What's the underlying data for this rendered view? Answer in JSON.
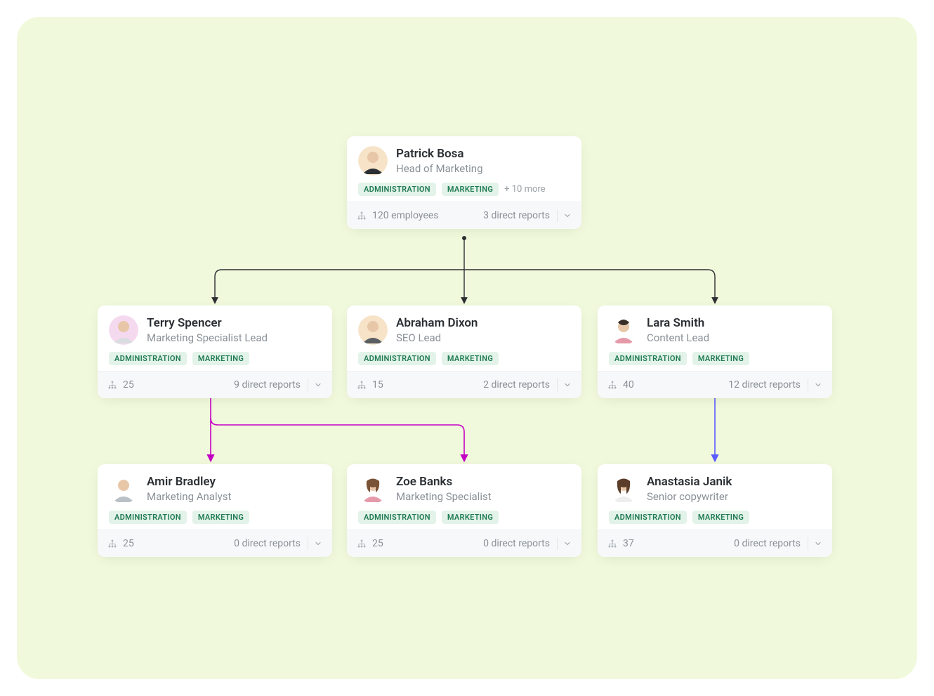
{
  "labels": {
    "employees_word": "employees",
    "direct_reports_word": "direct reports"
  },
  "tag_admin": "ADMINISTRATION",
  "tag_mkt": "MARKETING",
  "root": {
    "name": "Patrick Bosa",
    "title": "Head of Marketing",
    "more": "+ 10 more",
    "employees": "120 employees",
    "reports": "3 direct reports",
    "avatar_bg": "#f6e3c8",
    "avatar_shirt": "#2b2f33"
  },
  "row2": [
    {
      "name": "Terry Spencer",
      "title": "Marketing Specialist Lead",
      "employees": "25",
      "reports": "9 direct reports",
      "avatar_bg": "#f5d9ef",
      "avatar_shirt": "#d9dde0"
    },
    {
      "name": "Abraham Dixon",
      "title": "SEO Lead",
      "employees": "15",
      "reports": "2 direct reports",
      "avatar_bg": "#f6e3c8",
      "avatar_shirt": "#5a5f63"
    },
    {
      "name": "Lara Smith",
      "title": "Content Lead",
      "employees": "40",
      "reports": "12 direct reports",
      "avatar_bg": "#ffffff",
      "avatar_shirt": "#e59aa9"
    }
  ],
  "row3": [
    {
      "name": "Amir Bradley",
      "title": "Marketing Analyst",
      "employees": "25",
      "reports": "0 direct reports",
      "avatar_bg": "#ffffff",
      "avatar_shirt": "#b9c0c6"
    },
    {
      "name": "Zoe Banks",
      "title": "Marketing Specialist",
      "employees": "25",
      "reports": "0 direct reports",
      "avatar_bg": "#ffffff",
      "avatar_shirt": "#e59aa9"
    },
    {
      "name": "Anastasia Janik",
      "title": "Senior copywriter",
      "employees": "37",
      "reports": "0 direct reports",
      "avatar_bg": "#ffffff",
      "avatar_shirt": "#eeeeee"
    }
  ],
  "connectors": {
    "main": "#2b2f33",
    "magenta": "#c400c4",
    "violet": "#5b5bff"
  }
}
